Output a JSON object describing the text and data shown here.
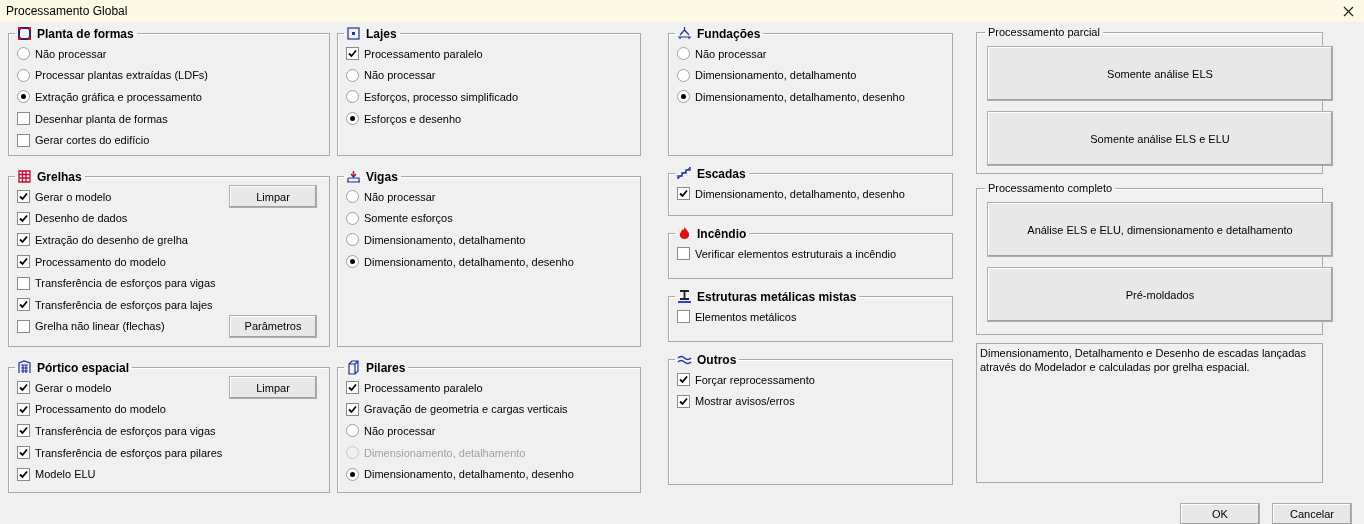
{
  "window": {
    "title": "Processamento Global"
  },
  "columns": [
    {
      "groups": [
        {
          "title": "Planta de formas",
          "items": [
            {
              "kind": "radio",
              "label": "Não processar",
              "checked": false,
              "disabled": false
            },
            {
              "kind": "radio",
              "label": "Processar plantas extraídas (LDFs)",
              "checked": false,
              "disabled": false
            },
            {
              "kind": "radio",
              "label": "Extração gráfica e processamento",
              "checked": true,
              "disabled": false
            },
            {
              "kind": "check",
              "label": "Desenhar planta de formas",
              "checked": false,
              "disabled": false
            },
            {
              "kind": "check",
              "label": "Gerar cortes do edifício",
              "checked": false,
              "disabled": false
            }
          ]
        },
        {
          "title": "Grelhas",
          "items": [
            {
              "kind": "check",
              "label": "Gerar o modelo",
              "checked": true,
              "disabled": false,
              "button": "Limpar"
            },
            {
              "kind": "check",
              "label": "Desenho de dados",
              "checked": true,
              "disabled": false
            },
            {
              "kind": "check",
              "label": "Extração do desenho de grelha",
              "checked": true,
              "disabled": false
            },
            {
              "kind": "check",
              "label": "Processamento do modelo",
              "checked": true,
              "disabled": false
            },
            {
              "kind": "check",
              "label": "Transferência de esforços para vigas",
              "checked": false,
              "disabled": false
            },
            {
              "kind": "check",
              "label": "Transferência de esforços para lajes",
              "checked": true,
              "disabled": false
            },
            {
              "kind": "check",
              "label": "Grelha não linear (flechas)",
              "checked": false,
              "disabled": false,
              "button": "Parâmetros"
            }
          ]
        },
        {
          "title": "Pórtico espacial",
          "items": [
            {
              "kind": "check",
              "label": "Gerar o modelo",
              "checked": true,
              "disabled": false,
              "button": "Limpar"
            },
            {
              "kind": "check",
              "label": "Processamento do modelo",
              "checked": true,
              "disabled": false
            },
            {
              "kind": "check",
              "label": "Transferência de esforços para vigas",
              "checked": true,
              "disabled": false
            },
            {
              "kind": "check",
              "label": "Transferência de esforços para pilares",
              "checked": true,
              "disabled": false
            },
            {
              "kind": "check",
              "label": "Modelo ELU",
              "checked": true,
              "disabled": false
            }
          ]
        }
      ]
    },
    {
      "groups": [
        {
          "title": "Lajes",
          "items": [
            {
              "kind": "check",
              "label": "Processamento paralelo",
              "checked": true,
              "disabled": false
            },
            {
              "kind": "radio",
              "label": "Não processar",
              "checked": false,
              "disabled": false
            },
            {
              "kind": "radio",
              "label": "Esforços, processo simplificado",
              "checked": false,
              "disabled": false
            },
            {
              "kind": "radio",
              "label": "Esforços e desenho",
              "checked": true,
              "disabled": false
            }
          ]
        },
        {
          "title": "Vigas",
          "items": [
            {
              "kind": "radio",
              "label": "Não processar",
              "checked": false,
              "disabled": false
            },
            {
              "kind": "radio",
              "label": "Somente esforços",
              "checked": false,
              "disabled": false
            },
            {
              "kind": "radio",
              "label": "Dimensionamento, detalhamento",
              "checked": false,
              "disabled": false
            },
            {
              "kind": "radio",
              "label": "Dimensionamento, detalhamento, desenho",
              "checked": true,
              "disabled": false
            }
          ]
        },
        {
          "title": "Pilares",
          "items": [
            {
              "kind": "check",
              "label": "Processamento paralelo",
              "checked": true,
              "disabled": false
            },
            {
              "kind": "check",
              "label": "Gravação de geometria e cargas verticais",
              "checked": true,
              "disabled": false
            },
            {
              "kind": "radio",
              "label": "Não processar",
              "checked": false,
              "disabled": false
            },
            {
              "kind": "radio",
              "label": "Dimensionamento, detalhamento",
              "checked": false,
              "disabled": true
            },
            {
              "kind": "radio",
              "label": "Dimensionamento, detalhamento, desenho",
              "checked": true,
              "disabled": false
            }
          ]
        }
      ]
    },
    {
      "groups": [
        {
          "title": "Fundações",
          "items": [
            {
              "kind": "radio",
              "label": "Não processar",
              "checked": false,
              "disabled": false
            },
            {
              "kind": "radio",
              "label": "Dimensionamento, detalhamento",
              "checked": false,
              "disabled": false
            },
            {
              "kind": "radio",
              "label": "Dimensionamento, detalhamento, desenho",
              "checked": true,
              "disabled": false
            }
          ]
        },
        {
          "title": "Escadas",
          "items": [
            {
              "kind": "check",
              "label": "Dimensionamento, detalhamento, desenho",
              "checked": true,
              "disabled": false
            }
          ]
        },
        {
          "title": "Incêndio",
          "items": [
            {
              "kind": "check",
              "label": "Verificar elementos estruturais a incêndio",
              "checked": false,
              "disabled": false
            }
          ]
        },
        {
          "title": "Estruturas metálicas mistas",
          "items": [
            {
              "kind": "check",
              "label": "Elementos metálicos",
              "checked": false,
              "disabled": false
            }
          ]
        },
        {
          "title": "Outros",
          "items": [
            {
              "kind": "check",
              "label": "Forçar reprocessamento",
              "checked": true,
              "disabled": false
            },
            {
              "kind": "check",
              "label": "Mostrar avisos/erros",
              "checked": true,
              "disabled": false
            }
          ]
        }
      ]
    }
  ],
  "partial": {
    "title": "Processamento parcial",
    "buttons": [
      "Somente análise ELS",
      "Somente análise ELS e ELU"
    ]
  },
  "complete": {
    "title": "Processamento completo",
    "buttons": [
      "Análise ELS e ELU, dimensionamento e detalhamento",
      "Pré-moldados"
    ]
  },
  "description": "Dimensionamento, Detalhamento e Desenho de escadas lançadas através do Modelador e calculadas por grelha espacial.",
  "footer_buttons": [
    "OK",
    "Cancelar"
  ]
}
